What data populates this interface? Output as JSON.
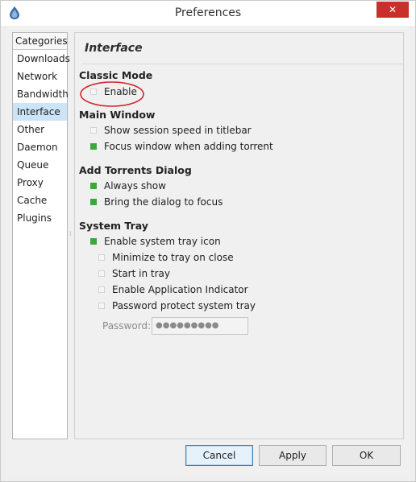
{
  "window": {
    "title": "Preferences",
    "close_glyph": "✕"
  },
  "categories": {
    "header": "Categories",
    "items": [
      "Downloads",
      "Network",
      "Bandwidth",
      "Interface",
      "Other",
      "Daemon",
      "Queue",
      "Proxy",
      "Cache",
      "Plugins"
    ],
    "selected": "Interface"
  },
  "panel": {
    "title": "Interface",
    "classic_mode": {
      "heading": "Classic Mode",
      "enable": {
        "label": "Enable",
        "checked": false
      }
    },
    "main_window": {
      "heading": "Main Window",
      "show_speed": {
        "label": "Show session speed in titlebar",
        "checked": false
      },
      "focus_window": {
        "label": "Focus window when adding torrent",
        "checked": true
      }
    },
    "add_torrents": {
      "heading": "Add Torrents Dialog",
      "always_show": {
        "label": "Always show",
        "checked": true
      },
      "bring_to_focus": {
        "label": "Bring the dialog to focus",
        "checked": true
      }
    },
    "system_tray": {
      "heading": "System Tray",
      "enable_icon": {
        "label": "Enable system tray icon",
        "checked": true
      },
      "minimize": {
        "label": "Minimize to tray on close",
        "checked": false
      },
      "start_in_tray": {
        "label": "Start in tray",
        "checked": false
      },
      "app_indicator": {
        "label": "Enable Application Indicator",
        "checked": false
      },
      "password_protect": {
        "label": "Password protect system tray",
        "checked": false
      },
      "password_label": "Password:",
      "password_value": "●●●●●●●●●"
    }
  },
  "buttons": {
    "cancel": "Cancel",
    "apply": "Apply",
    "ok": "OK"
  },
  "colors": {
    "checked": "#3ca83c",
    "selected_bg": "#cce4f7",
    "close_bg": "#c7302b",
    "annotation": "#d0262b"
  },
  "icons": {
    "app": "deluge-drop-icon",
    "close": "close-icon"
  }
}
